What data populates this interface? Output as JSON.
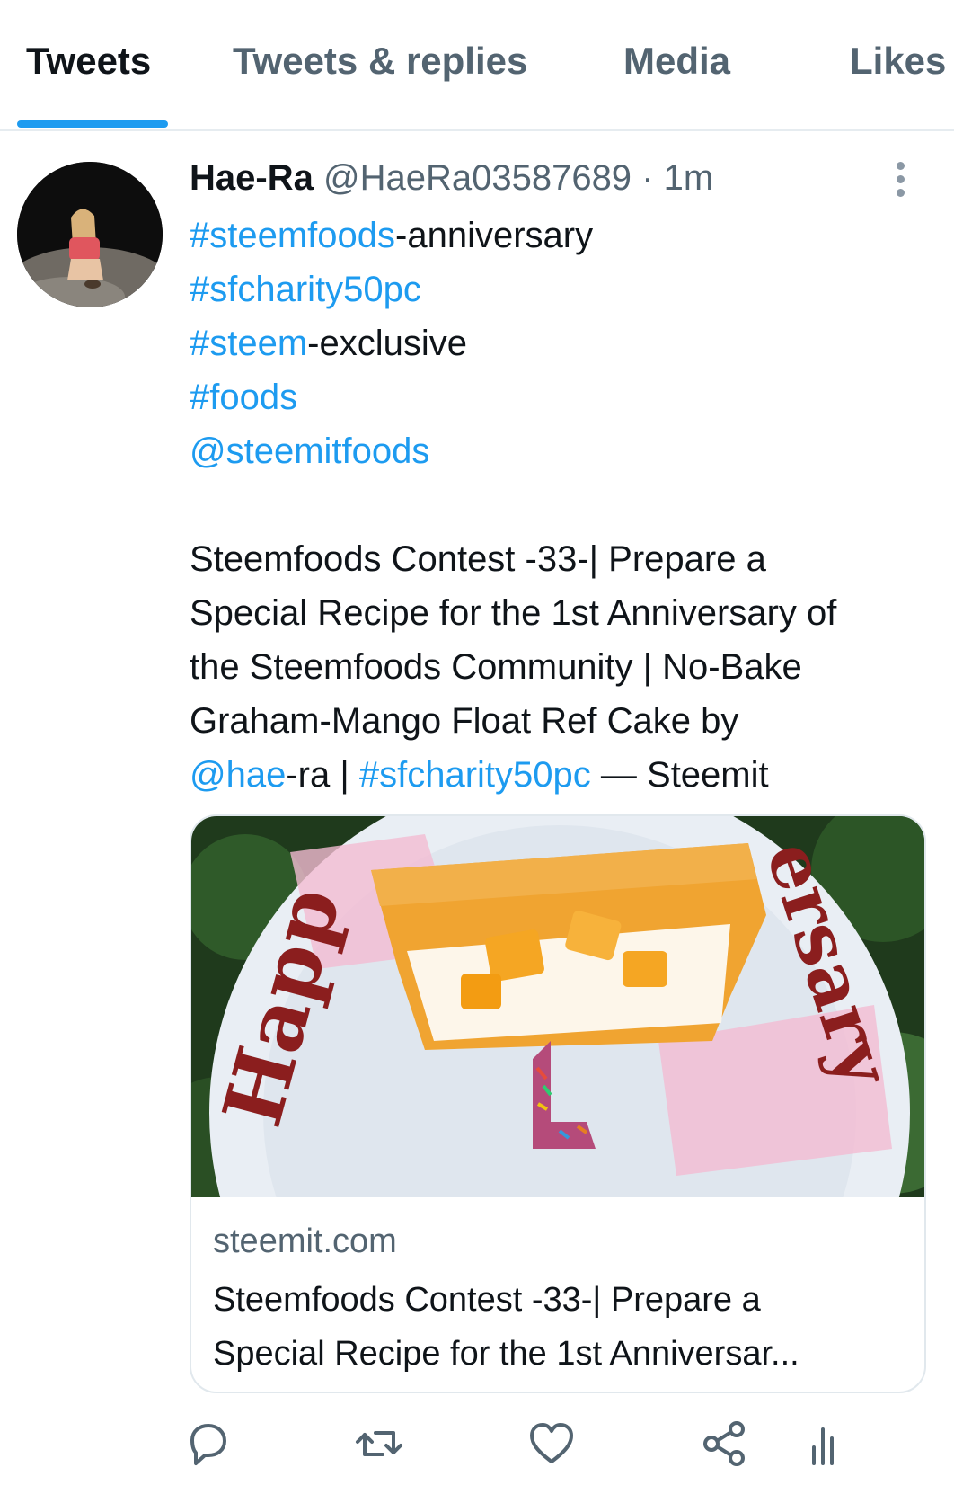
{
  "tabs": [
    {
      "label": "Tweets",
      "active": true
    },
    {
      "label": "Tweets & replies",
      "active": false
    },
    {
      "label": "Media",
      "active": false
    },
    {
      "label": "Likes",
      "active": false
    }
  ],
  "tweet": {
    "author_name": "Hae-Ra",
    "handle": "@HaeRa03587689",
    "separator": "·",
    "time": "1m",
    "lines": {
      "l1_tag": "#steemfoods",
      "l1_rest": "-anniversary",
      "l2_tag": "#sfcharity50pc",
      "l3_tag": "#steem",
      "l3_rest": "-exclusive",
      "l4_tag": "#foods",
      "l5_mention": "@steemitfoods",
      "p1": "Steemfoods Contest -33-| Prepare a",
      "p2": "Special Recipe for the 1st Anniversary of",
      "p3": "the Steemfoods Community | No-Bake",
      "p4": "Graham-Mango Float Ref Cake by",
      "p5_mention": "@hae",
      "p5_a": "-ra | ",
      "p5_tag": "#sfcharity50pc",
      "p5_b": " — Steemit"
    },
    "card": {
      "image_icing_text_left": "Happ",
      "image_icing_text_right": "ersary",
      "domain": "steemit.com",
      "title_line1": "Steemfoods Contest -33-| Prepare a",
      "title_line2": "Special Recipe for the 1st Anniversar..."
    }
  },
  "icons": [
    "more-vertical-icon",
    "reply-icon",
    "retweet-icon",
    "like-icon",
    "share-icon",
    "analytics-icon"
  ],
  "colors": {
    "accent": "#1d9bf0",
    "secondary_text": "#536471",
    "primary_text": "#0f1419",
    "border": "#e1e8ed"
  }
}
